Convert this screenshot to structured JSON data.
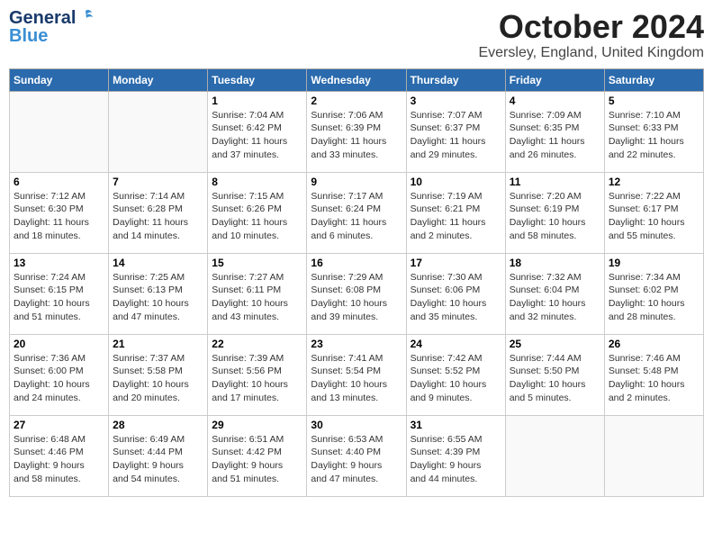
{
  "header": {
    "logo_general": "General",
    "logo_blue": "Blue",
    "month_title": "October 2024",
    "location": "Eversley, England, United Kingdom"
  },
  "days_of_week": [
    "Sunday",
    "Monday",
    "Tuesday",
    "Wednesday",
    "Thursday",
    "Friday",
    "Saturday"
  ],
  "weeks": [
    [
      {
        "day": "",
        "info": ""
      },
      {
        "day": "",
        "info": ""
      },
      {
        "day": "1",
        "info": "Sunrise: 7:04 AM\nSunset: 6:42 PM\nDaylight: 11 hours\nand 37 minutes."
      },
      {
        "day": "2",
        "info": "Sunrise: 7:06 AM\nSunset: 6:39 PM\nDaylight: 11 hours\nand 33 minutes."
      },
      {
        "day": "3",
        "info": "Sunrise: 7:07 AM\nSunset: 6:37 PM\nDaylight: 11 hours\nand 29 minutes."
      },
      {
        "day": "4",
        "info": "Sunrise: 7:09 AM\nSunset: 6:35 PM\nDaylight: 11 hours\nand 26 minutes."
      },
      {
        "day": "5",
        "info": "Sunrise: 7:10 AM\nSunset: 6:33 PM\nDaylight: 11 hours\nand 22 minutes."
      }
    ],
    [
      {
        "day": "6",
        "info": "Sunrise: 7:12 AM\nSunset: 6:30 PM\nDaylight: 11 hours\nand 18 minutes."
      },
      {
        "day": "7",
        "info": "Sunrise: 7:14 AM\nSunset: 6:28 PM\nDaylight: 11 hours\nand 14 minutes."
      },
      {
        "day": "8",
        "info": "Sunrise: 7:15 AM\nSunset: 6:26 PM\nDaylight: 11 hours\nand 10 minutes."
      },
      {
        "day": "9",
        "info": "Sunrise: 7:17 AM\nSunset: 6:24 PM\nDaylight: 11 hours\nand 6 minutes."
      },
      {
        "day": "10",
        "info": "Sunrise: 7:19 AM\nSunset: 6:21 PM\nDaylight: 11 hours\nand 2 minutes."
      },
      {
        "day": "11",
        "info": "Sunrise: 7:20 AM\nSunset: 6:19 PM\nDaylight: 10 hours\nand 58 minutes."
      },
      {
        "day": "12",
        "info": "Sunrise: 7:22 AM\nSunset: 6:17 PM\nDaylight: 10 hours\nand 55 minutes."
      }
    ],
    [
      {
        "day": "13",
        "info": "Sunrise: 7:24 AM\nSunset: 6:15 PM\nDaylight: 10 hours\nand 51 minutes."
      },
      {
        "day": "14",
        "info": "Sunrise: 7:25 AM\nSunset: 6:13 PM\nDaylight: 10 hours\nand 47 minutes."
      },
      {
        "day": "15",
        "info": "Sunrise: 7:27 AM\nSunset: 6:11 PM\nDaylight: 10 hours\nand 43 minutes."
      },
      {
        "day": "16",
        "info": "Sunrise: 7:29 AM\nSunset: 6:08 PM\nDaylight: 10 hours\nand 39 minutes."
      },
      {
        "day": "17",
        "info": "Sunrise: 7:30 AM\nSunset: 6:06 PM\nDaylight: 10 hours\nand 35 minutes."
      },
      {
        "day": "18",
        "info": "Sunrise: 7:32 AM\nSunset: 6:04 PM\nDaylight: 10 hours\nand 32 minutes."
      },
      {
        "day": "19",
        "info": "Sunrise: 7:34 AM\nSunset: 6:02 PM\nDaylight: 10 hours\nand 28 minutes."
      }
    ],
    [
      {
        "day": "20",
        "info": "Sunrise: 7:36 AM\nSunset: 6:00 PM\nDaylight: 10 hours\nand 24 minutes."
      },
      {
        "day": "21",
        "info": "Sunrise: 7:37 AM\nSunset: 5:58 PM\nDaylight: 10 hours\nand 20 minutes."
      },
      {
        "day": "22",
        "info": "Sunrise: 7:39 AM\nSunset: 5:56 PM\nDaylight: 10 hours\nand 17 minutes."
      },
      {
        "day": "23",
        "info": "Sunrise: 7:41 AM\nSunset: 5:54 PM\nDaylight: 10 hours\nand 13 minutes."
      },
      {
        "day": "24",
        "info": "Sunrise: 7:42 AM\nSunset: 5:52 PM\nDaylight: 10 hours\nand 9 minutes."
      },
      {
        "day": "25",
        "info": "Sunrise: 7:44 AM\nSunset: 5:50 PM\nDaylight: 10 hours\nand 5 minutes."
      },
      {
        "day": "26",
        "info": "Sunrise: 7:46 AM\nSunset: 5:48 PM\nDaylight: 10 hours\nand 2 minutes."
      }
    ],
    [
      {
        "day": "27",
        "info": "Sunrise: 6:48 AM\nSunset: 4:46 PM\nDaylight: 9 hours\nand 58 minutes."
      },
      {
        "day": "28",
        "info": "Sunrise: 6:49 AM\nSunset: 4:44 PM\nDaylight: 9 hours\nand 54 minutes."
      },
      {
        "day": "29",
        "info": "Sunrise: 6:51 AM\nSunset: 4:42 PM\nDaylight: 9 hours\nand 51 minutes."
      },
      {
        "day": "30",
        "info": "Sunrise: 6:53 AM\nSunset: 4:40 PM\nDaylight: 9 hours\nand 47 minutes."
      },
      {
        "day": "31",
        "info": "Sunrise: 6:55 AM\nSunset: 4:39 PM\nDaylight: 9 hours\nand 44 minutes."
      },
      {
        "day": "",
        "info": ""
      },
      {
        "day": "",
        "info": ""
      }
    ]
  ]
}
